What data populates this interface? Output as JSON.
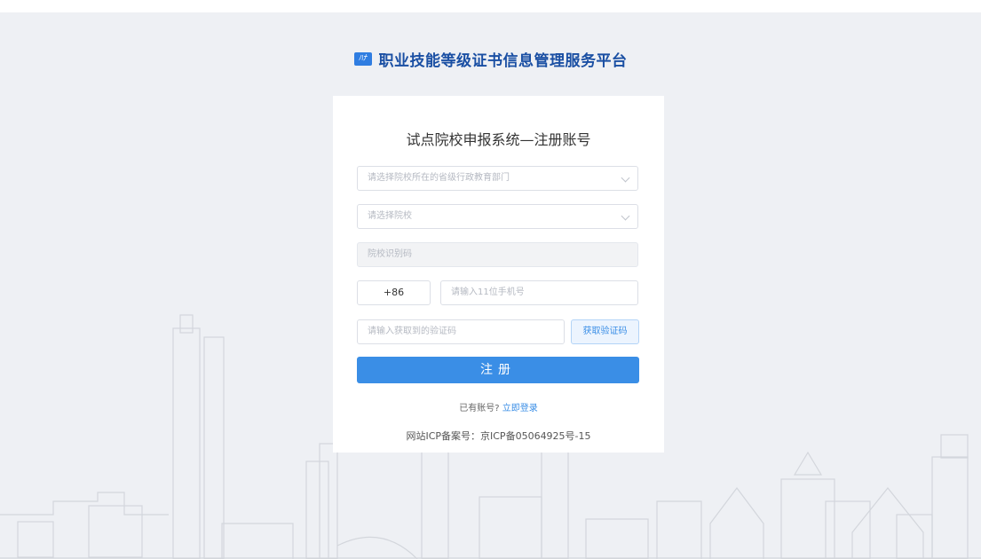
{
  "brand": {
    "logo_text": "ﾊﾅ",
    "title": "职业技能等级证书信息管理服务平台"
  },
  "form": {
    "title": "试点院校申报系统—注册账号",
    "province_select_placeholder": "请选择院校所在的省级行政教育部门",
    "school_select_placeholder": "请选择院校",
    "school_code_placeholder": "院校识别码",
    "country_code": "+86",
    "phone_placeholder": "请输入11位手机号",
    "sms_code_placeholder": "请输入获取到的验证码",
    "get_code_label": "获取验证码",
    "submit_label": "注册",
    "has_account_text": "已有账号?",
    "login_link_label": "立即登录"
  },
  "footer": {
    "icp": "网站ICP备案号：京ICP备05064925号-15"
  },
  "colors": {
    "accent": "#3a8ee6",
    "brand": "#1a4fa3",
    "background": "#eef0f4"
  }
}
